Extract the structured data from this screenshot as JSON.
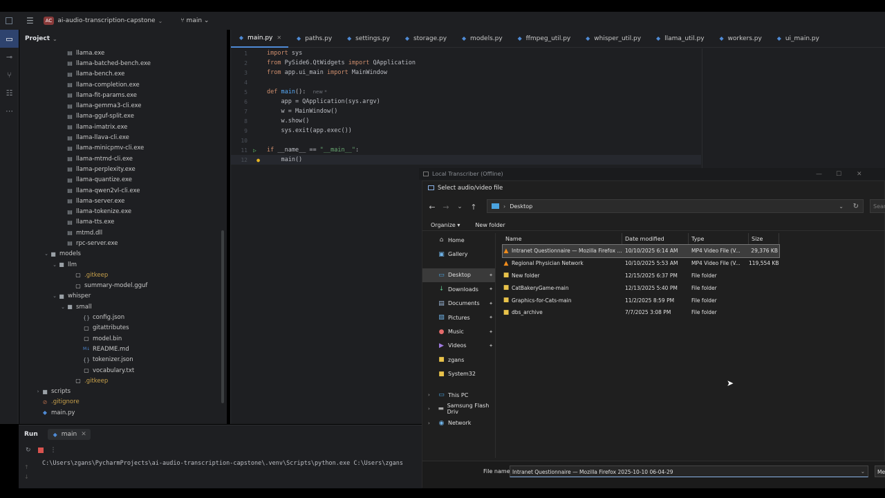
{
  "ide": {
    "project_badge": "AC",
    "project_name": "ai-audio-transcription-capstone",
    "branch": "main",
    "project_panel_title": "Project"
  },
  "tree": [
    {
      "name": "llama.exe",
      "indent": 4,
      "kind": "exe"
    },
    {
      "name": "llama-batched-bench.exe",
      "indent": 4,
      "kind": "exe"
    },
    {
      "name": "llama-bench.exe",
      "indent": 4,
      "kind": "exe"
    },
    {
      "name": "llama-completion.exe",
      "indent": 4,
      "kind": "exe"
    },
    {
      "name": "llama-fit-params.exe",
      "indent": 4,
      "kind": "exe"
    },
    {
      "name": "llama-gemma3-cli.exe",
      "indent": 4,
      "kind": "exe"
    },
    {
      "name": "llama-gguf-split.exe",
      "indent": 4,
      "kind": "exe"
    },
    {
      "name": "llama-imatrix.exe",
      "indent": 4,
      "kind": "exe"
    },
    {
      "name": "llama-llava-cli.exe",
      "indent": 4,
      "kind": "exe"
    },
    {
      "name": "llama-minicpmv-cli.exe",
      "indent": 4,
      "kind": "exe"
    },
    {
      "name": "llama-mtmd-cli.exe",
      "indent": 4,
      "kind": "exe"
    },
    {
      "name": "llama-perplexity.exe",
      "indent": 4,
      "kind": "exe"
    },
    {
      "name": "llama-quantize.exe",
      "indent": 4,
      "kind": "exe"
    },
    {
      "name": "llama-qwen2vl-cli.exe",
      "indent": 4,
      "kind": "exe"
    },
    {
      "name": "llama-server.exe",
      "indent": 4,
      "kind": "exe"
    },
    {
      "name": "llama-tokenize.exe",
      "indent": 4,
      "kind": "exe"
    },
    {
      "name": "llama-tts.exe",
      "indent": 4,
      "kind": "exe"
    },
    {
      "name": "mtmd.dll",
      "indent": 4,
      "kind": "exe"
    },
    {
      "name": "rpc-server.exe",
      "indent": 4,
      "kind": "exe"
    },
    {
      "name": "models",
      "indent": 2,
      "kind": "folder",
      "open": true
    },
    {
      "name": "llm",
      "indent": 3,
      "kind": "folder",
      "open": true
    },
    {
      "name": ".gitkeep",
      "indent": 5,
      "kind": "file",
      "orange": true
    },
    {
      "name": "summary-model.gguf",
      "indent": 5,
      "kind": "file"
    },
    {
      "name": "whisper",
      "indent": 3,
      "kind": "folder",
      "open": true
    },
    {
      "name": "small",
      "indent": 4,
      "kind": "folder",
      "open": true
    },
    {
      "name": "config.json",
      "indent": 6,
      "kind": "json"
    },
    {
      "name": "gitattributes",
      "indent": 6,
      "kind": "file"
    },
    {
      "name": "model.bin",
      "indent": 6,
      "kind": "file"
    },
    {
      "name": "README.md",
      "indent": 6,
      "kind": "md"
    },
    {
      "name": "tokenizer.json",
      "indent": 6,
      "kind": "json"
    },
    {
      "name": "vocabulary.txt",
      "indent": 6,
      "kind": "file"
    },
    {
      "name": ".gitkeep",
      "indent": 5,
      "kind": "file",
      "orange": true
    },
    {
      "name": "scripts",
      "indent": 1,
      "kind": "folder",
      "open": false
    },
    {
      "name": ".gitignore",
      "indent": 1,
      "kind": "git",
      "orange": true
    },
    {
      "name": "main.py",
      "indent": 1,
      "kind": "py"
    }
  ],
  "editor_tabs": [
    {
      "label": "main.py",
      "active": true
    },
    {
      "label": "paths.py"
    },
    {
      "label": "settings.py"
    },
    {
      "label": "storage.py"
    },
    {
      "label": "models.py"
    },
    {
      "label": "ffmpeg_util.py"
    },
    {
      "label": "whisper_util.py"
    },
    {
      "label": "llama_util.py"
    },
    {
      "label": "workers.py"
    },
    {
      "label": "ui_main.py"
    }
  ],
  "code_lines": [
    [
      {
        "t": "import",
        "c": "kw"
      },
      {
        "t": " sys"
      }
    ],
    [
      {
        "t": "from",
        "c": "kw"
      },
      {
        "t": " PySide6.QtWidgets "
      },
      {
        "t": "import",
        "c": "kw"
      },
      {
        "t": " QApplication"
      }
    ],
    [
      {
        "t": "from",
        "c": "kw"
      },
      {
        "t": " app.ui_main "
      },
      {
        "t": "import",
        "c": "kw"
      },
      {
        "t": " MainWindow"
      }
    ],
    [],
    [
      {
        "t": "def",
        "c": "kw"
      },
      {
        "t": " "
      },
      {
        "t": "main",
        "c": "fn"
      },
      {
        "t": "():  "
      },
      {
        "t": "new *",
        "c": "hint"
      }
    ],
    [
      {
        "t": "    app = QApplication(sys.argv)"
      }
    ],
    [
      {
        "t": "    w = MainWindow()"
      }
    ],
    [
      {
        "t": "    w.show()"
      }
    ],
    [
      {
        "t": "    sys.exit(app.exec())"
      }
    ],
    [],
    [
      {
        "t": "if",
        "c": "kw"
      },
      {
        "t": " __name__ == "
      },
      {
        "t": "\"__main__\"",
        "c": "str"
      },
      {
        "t": ":"
      }
    ],
    [
      {
        "t": "    main()"
      }
    ]
  ],
  "run": {
    "label": "Run",
    "tab": "main",
    "output": "C:\\Users\\zgans\\PycharmProjects\\ai-audio-transcription-capstone\\.venv\\Scripts\\python.exe C:\\Users\\zgans"
  },
  "dialog": {
    "app_title": "Local Transcriber (Offline)",
    "title": "Select audio/video file",
    "address": "Desktop",
    "search_placeholder": "Search",
    "organize": "Organize",
    "new_folder": "New folder",
    "columns": {
      "name": "Name",
      "date": "Date modified",
      "type": "Type",
      "size": "Size"
    },
    "nav_items": [
      {
        "label": "Home",
        "icon": "home-icon",
        "glyph": "⌂"
      },
      {
        "label": "Gallery",
        "icon": "gallery-icon",
        "glyph": "▣"
      },
      {
        "gap": true
      },
      {
        "label": "Desktop",
        "icon": "desktop-icon",
        "glyph": "▭",
        "pinned": true,
        "selected": true
      },
      {
        "label": "Downloads",
        "icon": "download-icon",
        "glyph": "↓",
        "pinned": true
      },
      {
        "label": "Documents",
        "icon": "documents-icon",
        "glyph": "▤",
        "pinned": true
      },
      {
        "label": "Pictures",
        "icon": "pictures-icon",
        "glyph": "▧",
        "pinned": true
      },
      {
        "label": "Music",
        "icon": "music-icon",
        "glyph": "●",
        "pinned": true
      },
      {
        "label": "Videos",
        "icon": "videos-icon",
        "glyph": "▶",
        "pinned": true
      },
      {
        "label": "zgans",
        "icon": "folder-icon",
        "glyph": "■"
      },
      {
        "label": "System32",
        "icon": "folder-icon",
        "glyph": "■"
      },
      {
        "gap": true
      },
      {
        "label": "This PC",
        "icon": "pc-icon",
        "glyph": "▭",
        "expand": true
      },
      {
        "label": "Samsung Flash Driv",
        "icon": "drive-icon",
        "glyph": "▬",
        "expand": true
      },
      {
        "label": "Network",
        "icon": "network-icon",
        "glyph": "◉",
        "expand": true
      }
    ],
    "files": [
      {
        "name": "Intranet Questionnaire — Mozilla Firefox ...",
        "date": "10/10/2025 6:14 AM",
        "type": "MP4 Video File (V...",
        "size": "29,376 KB",
        "kind": "video",
        "selected": true
      },
      {
        "name": "Regional Physician Network",
        "date": "10/10/2025 5:53 AM",
        "type": "MP4 Video File (V...",
        "size": "119,554 KB",
        "kind": "video"
      },
      {
        "name": "New folder",
        "date": "12/15/2025 6:37 PM",
        "type": "File folder",
        "size": "",
        "kind": "folder"
      },
      {
        "name": "CatBakeryGame-main",
        "date": "12/13/2025 5:40 PM",
        "type": "File folder",
        "size": "",
        "kind": "folder"
      },
      {
        "name": "Graphics-for-Cats-main",
        "date": "11/2/2025 8:59 PM",
        "type": "File folder",
        "size": "",
        "kind": "folder"
      },
      {
        "name": "dbs_archive",
        "date": "7/7/2025 3:08 PM",
        "type": "File folder",
        "size": "",
        "kind": "folder"
      }
    ],
    "file_name_label": "File name:",
    "file_name_value": "Intranet Questionnaire — Mozilla Firefox 2025-10-10 06-04-29",
    "filter_label": "Media"
  }
}
